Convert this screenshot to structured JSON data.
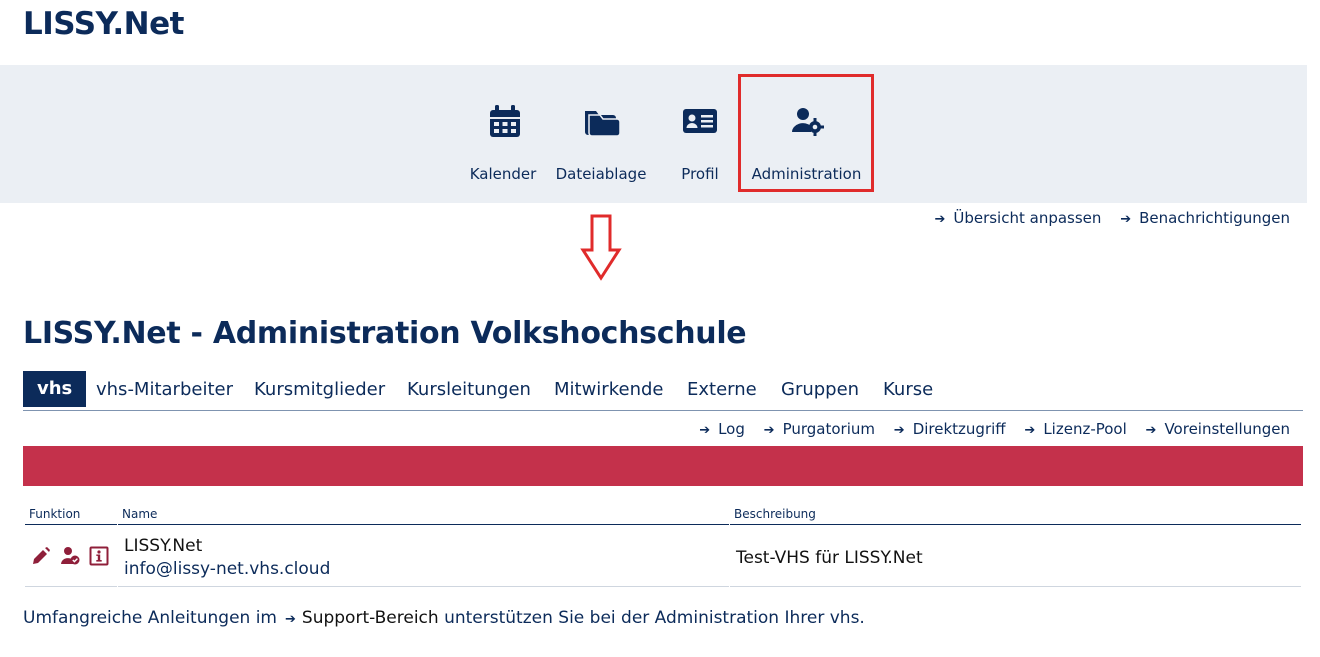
{
  "brand": "LISSY.Net",
  "nav": {
    "items": [
      {
        "label": "Kalender",
        "icon": "calendar-icon"
      },
      {
        "label": "Dateiablage",
        "icon": "folder-icon"
      },
      {
        "label": "Profil",
        "icon": "id-card-icon"
      },
      {
        "label": "Administration",
        "icon": "user-gear-icon"
      }
    ]
  },
  "top_links": [
    "Übersicht anpassen",
    "Benachrichtigungen"
  ],
  "page_title": "LISSY.Net - Administration Volkshochschule",
  "tabs": [
    "vhs",
    "vhs-Mitarbeiter",
    "Kursmitglieder",
    "Kursleitungen",
    "Mitwirkende",
    "Externe",
    "Gruppen",
    "Kurse"
  ],
  "sub_links": [
    "Log",
    "Purgatorium",
    "Direktzugriff",
    "Lizenz-Pool",
    "Voreinstellungen"
  ],
  "table": {
    "headers": [
      "Funktion",
      "Name",
      "Beschreibung"
    ],
    "rows": [
      {
        "name": "LISSY.Net",
        "email": "info@lissy-net.vhs.cloud",
        "description": "Test-VHS für LISSY.Net"
      }
    ]
  },
  "footer": {
    "before": "Umfangreiche Anleitungen im",
    "link": "Support-Bereich",
    "after": "unterstützen Sie bei der Administration Ihrer vhs."
  },
  "colors": {
    "primary": "#0c2b5a",
    "accent_red": "#c4314b",
    "highlight": "#e02b2b",
    "nav_bg": "#ebeff4"
  }
}
